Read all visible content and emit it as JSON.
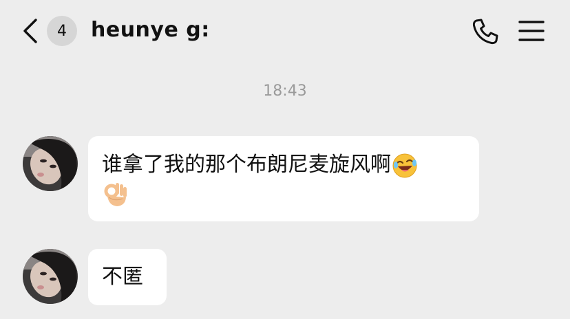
{
  "header": {
    "unread_count": "4",
    "title": "heunye g:"
  },
  "icons": {
    "back": "chevron-left-icon",
    "phone": "phone-icon",
    "menu": "menu-icon"
  },
  "timestamp": "18:43",
  "messages": [
    {
      "text": "谁拿了我的那个布朗尼麦旋风啊",
      "emojis": [
        "laughing-crying-face-emoji",
        "ok-hand-emoji"
      ]
    },
    {
      "text": "不匿"
    }
  ],
  "colors": {
    "background": "#ededed",
    "bubble": "#ffffff",
    "badge": "#d6d6d6",
    "timestamp": "#9a9a9a"
  }
}
